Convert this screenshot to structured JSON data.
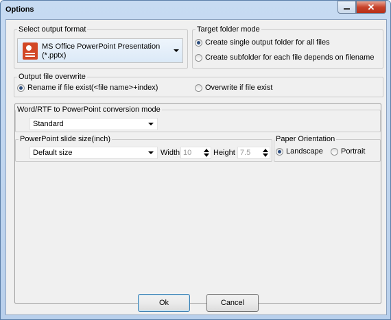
{
  "window": {
    "title": "Options"
  },
  "output_format": {
    "group_label": "Select output format",
    "selected": "MS Office PowerPoint Presentation (*.pptx)",
    "icon": "powerpoint-icon"
  },
  "target_folder": {
    "group_label": "Target folder mode",
    "options": [
      {
        "label": "Create single output folder for all files",
        "selected": true
      },
      {
        "label": "Create subfolder for each file depends on filename",
        "selected": false
      }
    ]
  },
  "overwrite": {
    "group_label": "Output file overwrite",
    "options": [
      {
        "label": "Rename if file exist(<file name>+index)",
        "selected": true
      },
      {
        "label": "Overwrite if file exist",
        "selected": false
      }
    ]
  },
  "conversion": {
    "group_label": "Word/RTF to PowerPoint conversion mode",
    "selected": "Standard"
  },
  "slide_size": {
    "group_label": "PowerPoint slide size(inch)",
    "selected": "Default size",
    "width_label": "Width",
    "width_value": "10",
    "height_label": "Height",
    "height_value": "7.5"
  },
  "orientation": {
    "group_label": "Paper Orientation",
    "options": [
      {
        "label": "Landscape",
        "selected": true
      },
      {
        "label": "Portrait",
        "selected": false
      }
    ]
  },
  "buttons": {
    "ok": "Ok",
    "cancel": "Cancel"
  }
}
